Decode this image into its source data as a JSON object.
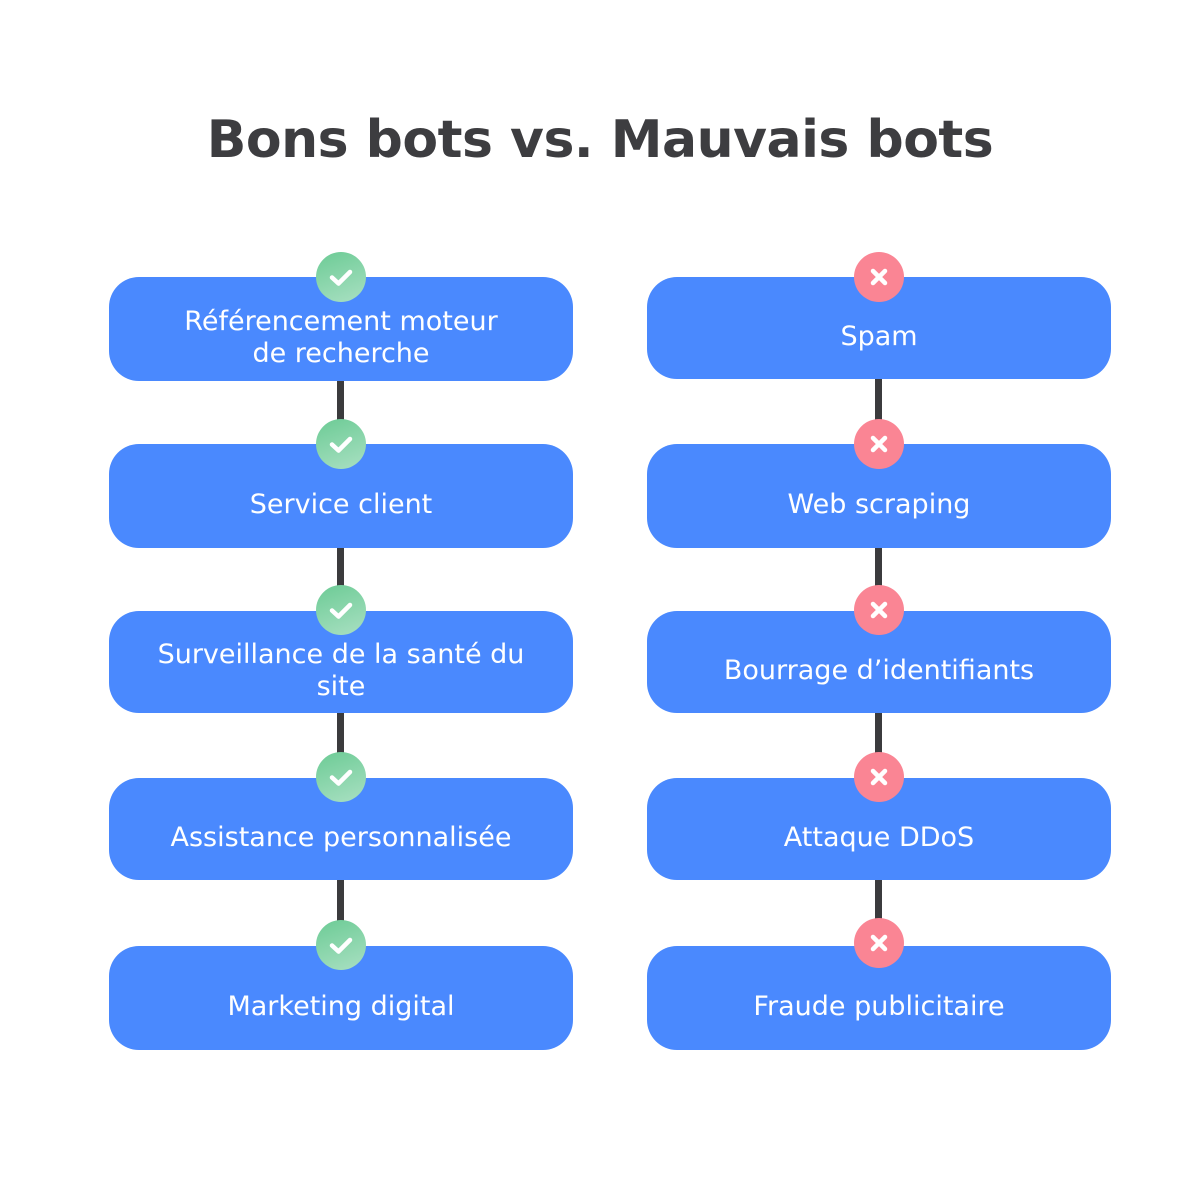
{
  "title": "Bons bots vs. Mauvais bots",
  "colors": {
    "box": "#4a89fe",
    "connector": "#3b3b3d",
    "good_badge": "#6ccb95",
    "bad_badge": "#fa8594",
    "title": "#3d3d40"
  },
  "good_bots": {
    "icon": "check-icon",
    "items": [
      {
        "label": "Référencement moteur\nde recherche"
      },
      {
        "label": "Service client"
      },
      {
        "label": "Surveillance de la santé du site"
      },
      {
        "label": "Assistance personnalisée"
      },
      {
        "label": "Marketing digital"
      }
    ]
  },
  "bad_bots": {
    "icon": "cross-icon",
    "items": [
      {
        "label": "Spam"
      },
      {
        "label": "Web scraping"
      },
      {
        "label": "Bourrage d’identifiants"
      },
      {
        "label": "Attaque DDoS"
      },
      {
        "label": "Fraude publicitaire"
      }
    ]
  }
}
